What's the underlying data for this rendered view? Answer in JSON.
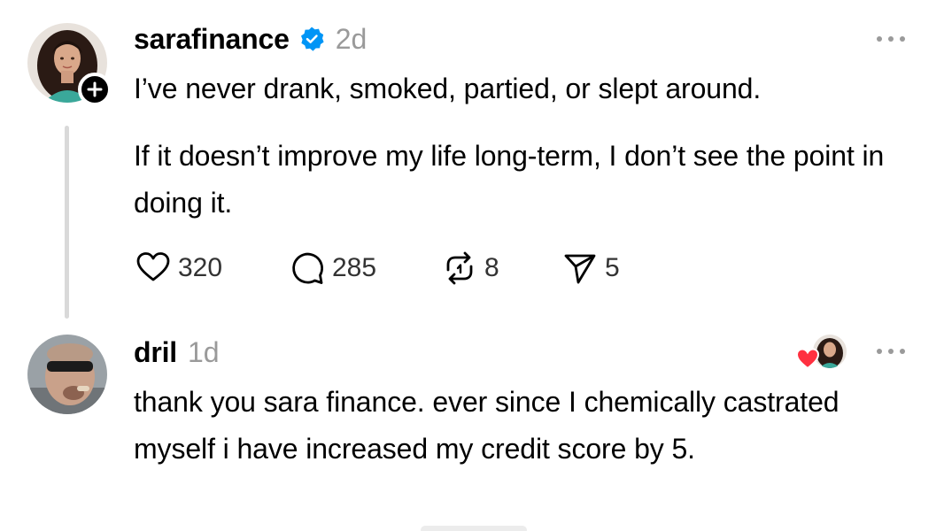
{
  "post": {
    "username": "sarafinance",
    "timestamp": "2d",
    "verified": true,
    "text_line1": "I’ve never drank, smoked, partied, or slept around.",
    "text_para2": "If it doesn’t improve my life long-term, I don’t see the point in doing it.",
    "actions": {
      "like_count": "320",
      "reply_count": "285",
      "repost_count": "8",
      "share_count": "5"
    },
    "icons": [
      "avatar",
      "follow-plus-icon",
      "verified-badge-icon",
      "more-options-icon",
      "heart-icon",
      "comment-icon",
      "repost-icon",
      "send-icon"
    ]
  },
  "reply": {
    "username": "dril",
    "timestamp": "1d",
    "text": "thank you sara finance. ever since I chemically castrated myself i have increased my credit score by 5.",
    "liked_by_author": true,
    "icons": [
      "avatar",
      "author-heart-icon",
      "more-options-icon"
    ]
  },
  "colors": {
    "text": "#000000",
    "muted": "#9a9a9a",
    "verified": "#0095f6",
    "heart": "#ff3040",
    "thread_line": "#d9d9d9"
  }
}
